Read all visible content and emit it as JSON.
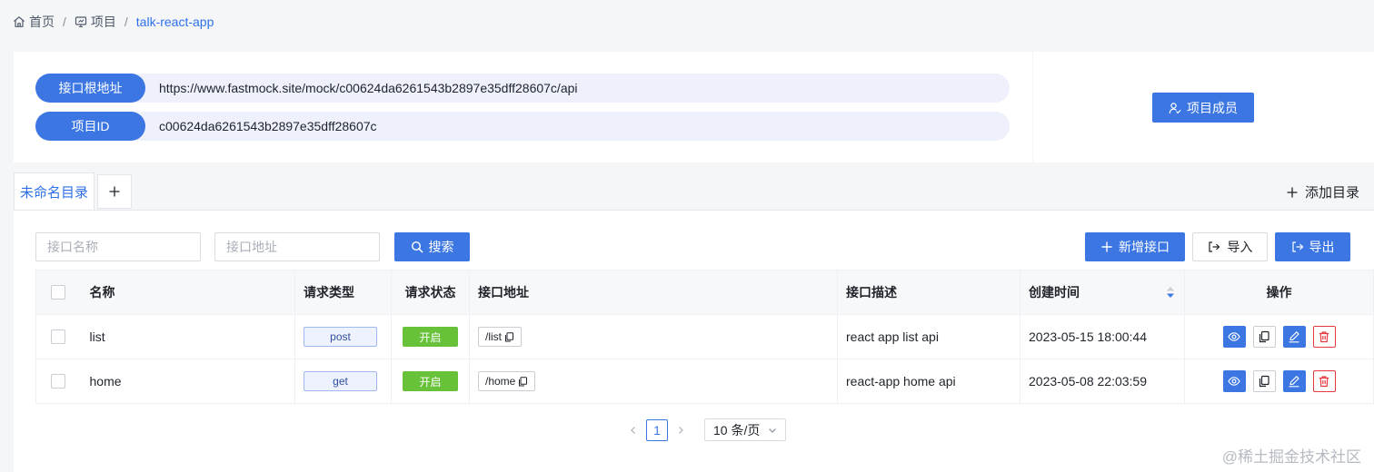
{
  "breadcrumb": {
    "home": "首页",
    "project": "项目",
    "current": "talk-react-app",
    "separator": "/"
  },
  "info": {
    "base_url_label": "接口根地址",
    "base_url_value": "https://www.fastmock.site/mock/c00624da6261543b2897e35dff28607c/api",
    "project_id_label": "项目ID",
    "project_id_value": "c00624da6261543b2897e35dff28607c"
  },
  "members_button": "项目成员",
  "tabs": {
    "active": "未命名目录",
    "add_directory": "添加目录"
  },
  "toolbar": {
    "name_placeholder": "接口名称",
    "path_placeholder": "接口地址",
    "search": "搜索",
    "add_api": "新增接口",
    "import": "导入",
    "export": "导出"
  },
  "table": {
    "headers": {
      "name": "名称",
      "method": "请求类型",
      "status": "请求状态",
      "path": "接口地址",
      "description": "接口描述",
      "created": "创建时间",
      "actions": "操作"
    },
    "rows": [
      {
        "name": "list",
        "method": "post",
        "status": "开启",
        "path": "/list",
        "description": "react app list api",
        "created": "2023-05-15 18:00:44"
      },
      {
        "name": "home",
        "method": "get",
        "status": "开启",
        "path": "/home",
        "description": "react-app home api",
        "created": "2023-05-08 22:03:59"
      }
    ]
  },
  "pagination": {
    "current_page": "1",
    "page_size": "10 条/页"
  },
  "watermark": "@稀土掘金技术社区",
  "colors": {
    "primary": "#3b76e3",
    "status_on": "#67c23a",
    "danger": "#e8393e"
  }
}
